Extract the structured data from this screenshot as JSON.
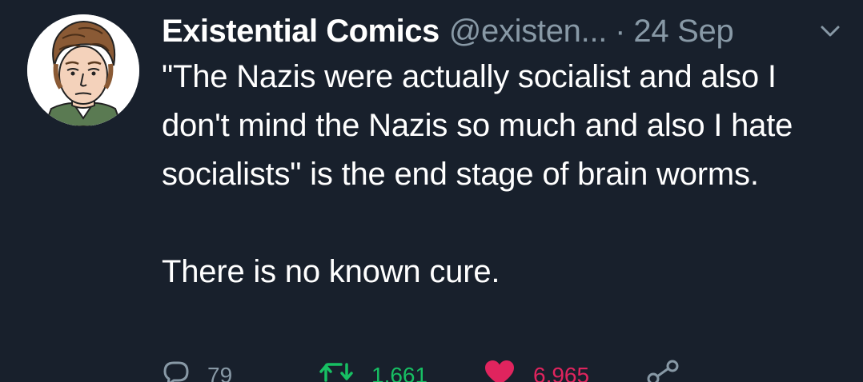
{
  "tweet": {
    "author_name": "Existential Comics",
    "handle": "@existen...",
    "separator": "·",
    "timestamp": "24 Sep",
    "text_paragraph_1": "\"The Nazis were actually socialist and also I don't mind the Nazis so much and also I hate socialists\" is the end stage of brain worms.",
    "text_paragraph_2": "There is no known cure."
  },
  "actions": {
    "reply_count": "79",
    "retweet_count": "1,661",
    "like_count": "6,965"
  },
  "icons": {
    "menu": "chevron-down-icon",
    "reply": "reply-bubble-icon",
    "retweet": "retweet-icon",
    "like": "heart-icon",
    "share": "share-icon"
  },
  "colors": {
    "background": "#18202c",
    "text": "#ffffff",
    "muted": "#8899a6",
    "retweet_active": "#17bf63",
    "like_active": "#e0245e"
  }
}
